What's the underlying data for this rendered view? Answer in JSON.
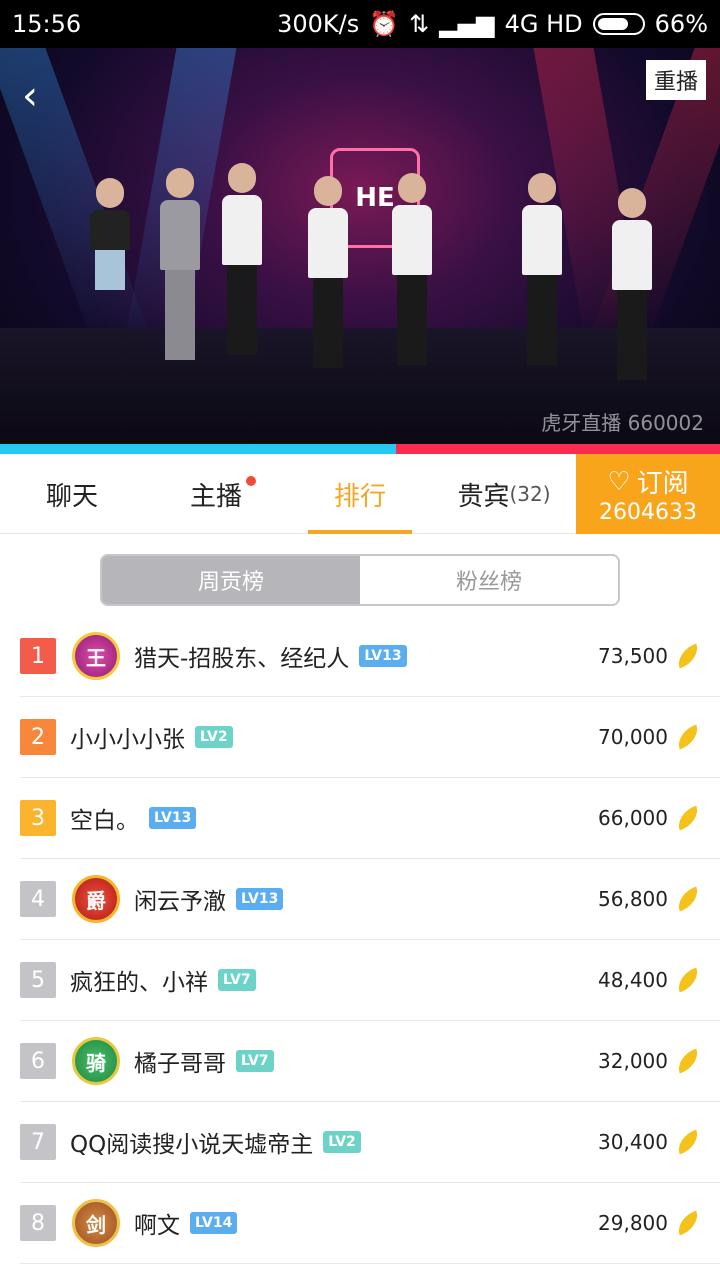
{
  "status_bar": {
    "time": "15:56",
    "network_speed": "300K/s",
    "network": "4G HD",
    "battery": "66%"
  },
  "video": {
    "replay_label": "重播",
    "watermark": "虎牙直播 660002",
    "logo_text": "HE"
  },
  "tabs": [
    {
      "label": "聊天"
    },
    {
      "label": "主播"
    },
    {
      "label": "排行"
    },
    {
      "label": "贵宾",
      "count": "(32)"
    }
  ],
  "subscribe": {
    "label": "订阅",
    "count": "2604633"
  },
  "segment": {
    "weekly": "周贡榜",
    "fans": "粉丝榜"
  },
  "ranking": [
    {
      "rank": "1",
      "badge": "王",
      "name": "猎天-招股东、经纪人",
      "level": "LV13",
      "score": "73,500"
    },
    {
      "rank": "2",
      "badge": "",
      "name": "小小小小张",
      "level": "LV2",
      "score": "70,000"
    },
    {
      "rank": "3",
      "badge": "",
      "name": "空白。",
      "level": "LV13",
      "score": "66,000"
    },
    {
      "rank": "4",
      "badge": "爵",
      "name": "闲云予澈",
      "level": "LV13",
      "score": "56,800"
    },
    {
      "rank": "5",
      "badge": "",
      "name": "疯狂的、小祥",
      "level": "LV7",
      "score": "48,400"
    },
    {
      "rank": "6",
      "badge": "骑",
      "name": "橘子哥哥",
      "level": "LV7",
      "score": "32,000"
    },
    {
      "rank": "7",
      "badge": "",
      "name": "QQ阅读搜小说天墟帝主",
      "level": "LV2",
      "score": "30,400"
    },
    {
      "rank": "8",
      "badge": "剑",
      "name": "啊文",
      "level": "LV14",
      "score": "29,800"
    }
  ]
}
